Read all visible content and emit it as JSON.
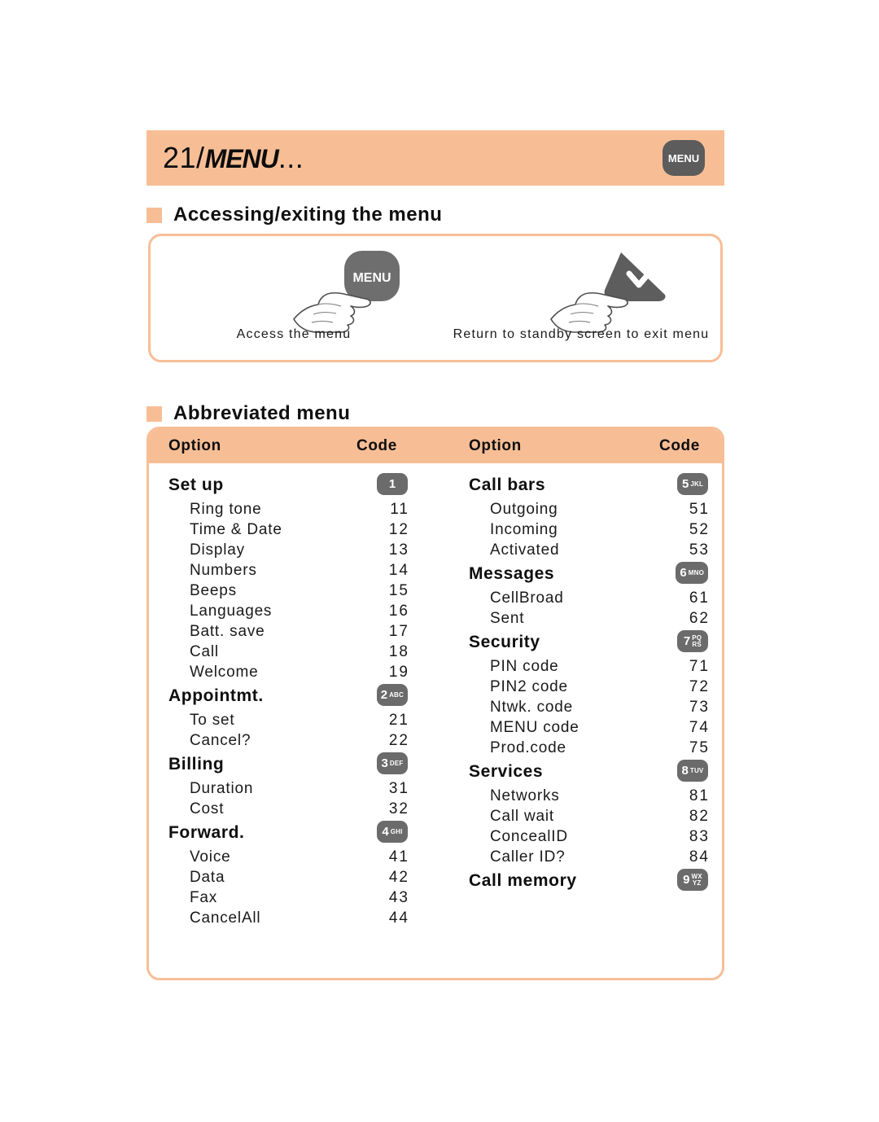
{
  "chapter": {
    "number": "21/",
    "word": "MENU",
    "ellipsis": "...",
    "key_badge": "MENU"
  },
  "sections": {
    "accessing": {
      "heading": "Accessing/exiting the menu",
      "bullet_color": "#f7be96",
      "left": {
        "caption": "Access the menu",
        "key_label": "MENU",
        "icon": "hand-pointing-icon"
      },
      "right": {
        "caption": "Return to standby screen to exit menu",
        "key_label": "",
        "icon": "hand-pointing-icon"
      }
    },
    "abbreviated": {
      "heading": "Abbreviated menu"
    }
  },
  "table": {
    "headers": {
      "option_left": "Option",
      "code_left": "Code",
      "option_right": "Option",
      "code_right": "Code"
    },
    "left_groups": [
      {
        "name": "Set up",
        "key": {
          "digit": "1",
          "letters": []
        },
        "items": [
          {
            "name": "Ring tone",
            "code": "11"
          },
          {
            "name": "Time & Date",
            "code": "12"
          },
          {
            "name": "Display",
            "code": "13"
          },
          {
            "name": "Numbers",
            "code": "14"
          },
          {
            "name": "Beeps",
            "code": "15"
          },
          {
            "name": "Languages",
            "code": "16"
          },
          {
            "name": "Batt. save",
            "code": "17"
          },
          {
            "name": "Call",
            "code": "18"
          },
          {
            "name": "Welcome",
            "code": "19"
          }
        ]
      },
      {
        "name": "Appointmt.",
        "key": {
          "digit": "2",
          "letters": [
            "ABC"
          ]
        },
        "items": [
          {
            "name": "To set",
            "code": "21"
          },
          {
            "name": "Cancel?",
            "code": "22"
          }
        ]
      },
      {
        "name": "Billing",
        "key": {
          "digit": "3",
          "letters": [
            "DEF"
          ]
        },
        "items": [
          {
            "name": "Duration",
            "code": "31"
          },
          {
            "name": "Cost",
            "code": "32"
          }
        ]
      },
      {
        "name": "Forward.",
        "key": {
          "digit": "4",
          "letters": [
            "GHI"
          ]
        },
        "items": [
          {
            "name": "Voice",
            "code": "41"
          },
          {
            "name": "Data",
            "code": "42"
          },
          {
            "name": "Fax",
            "code": "43"
          },
          {
            "name": "CancelAll",
            "code": "44"
          }
        ]
      }
    ],
    "right_groups": [
      {
        "name": "Call bars",
        "key": {
          "digit": "5",
          "letters": [
            "JKL"
          ]
        },
        "items": [
          {
            "name": "Outgoing",
            "code": "51"
          },
          {
            "name": "Incoming",
            "code": "52"
          },
          {
            "name": "Activated",
            "code": "53"
          }
        ]
      },
      {
        "name": "Messages",
        "key": {
          "digit": "6",
          "letters": [
            "MNO"
          ]
        },
        "items": [
          {
            "name": "CellBroad",
            "code": "61"
          },
          {
            "name": "Sent",
            "code": "62"
          }
        ]
      },
      {
        "name": "Security",
        "key": {
          "digit": "7",
          "letters": [
            "PQ",
            "RS"
          ]
        },
        "items": [
          {
            "name": "PIN code",
            "code": "71"
          },
          {
            "name": "PIN2 code",
            "code": "72"
          },
          {
            "name": "Ntwk. code",
            "code": "73"
          },
          {
            "name": "MENU code",
            "code": "74"
          },
          {
            "name": "Prod.code",
            "code": "75"
          }
        ]
      },
      {
        "name": "Services",
        "key": {
          "digit": "8",
          "letters": [
            "TUV"
          ]
        },
        "items": [
          {
            "name": "Networks",
            "code": "81"
          },
          {
            "name": "Call wait",
            "code": "82"
          },
          {
            "name": "ConcealID",
            "code": "83"
          },
          {
            "name": "Caller ID?",
            "code": "84"
          }
        ]
      },
      {
        "name": "Call memory",
        "key": {
          "digit": "9",
          "letters": [
            "WX",
            "YZ"
          ]
        },
        "items": []
      }
    ]
  },
  "colors": {
    "accent": "#f7be96",
    "key_grey": "#6b6b6b",
    "text": "#111111"
  }
}
